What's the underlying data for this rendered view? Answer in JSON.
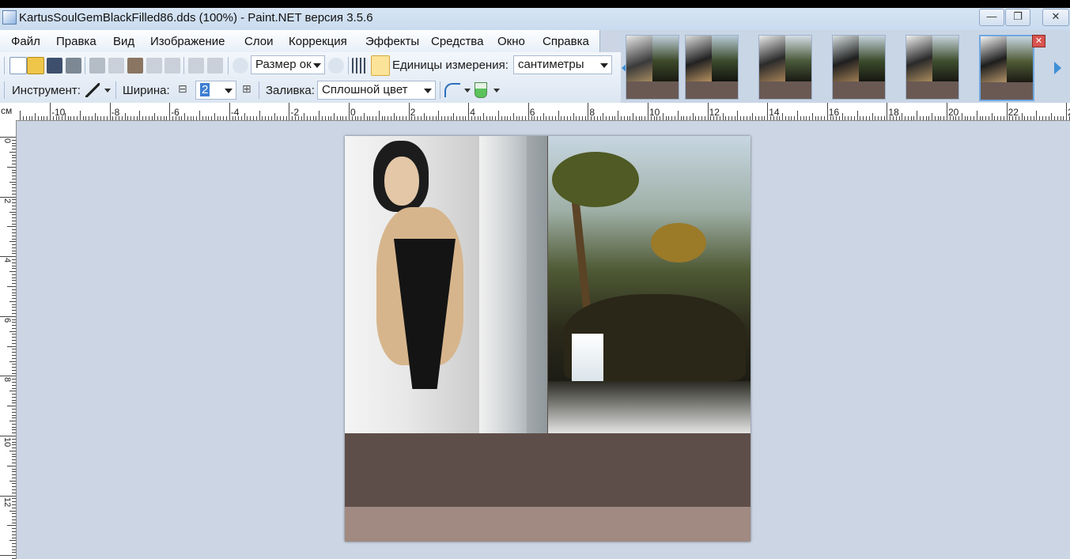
{
  "window": {
    "title": "KartusSoulGemBlackFilled86.dds (100%) - Paint.NET версия 3.5.6",
    "minimize_icon": "minimize-icon",
    "maximize_icon": "maximize-icon",
    "close_icon": "close-icon",
    "minimize_glyph": "—",
    "maximize_glyph": "❐",
    "close_glyph": "✕"
  },
  "menu": {
    "items": [
      "Файл",
      "Правка",
      "Вид",
      "Изображение",
      "Слои",
      "Коррекция",
      "Эффекты",
      "Средства",
      "Окно",
      "Справка"
    ]
  },
  "toolbar": {
    "zoom_value": "Размер ок",
    "units_label": "Единицы измерения:",
    "units_value": "сантиметры",
    "tool_label": "Инструмент:",
    "width_label": "Ширина:",
    "width_value": "2",
    "fill_label": "Заливка:",
    "fill_value": "Сплошной цвет",
    "minus_glyph": "⊟",
    "plus_glyph": "⊞"
  },
  "ruler": {
    "unit": "см",
    "h_labels": [
      "-10",
      "-8",
      "-6",
      "-4",
      "-2",
      "0",
      "2",
      "4",
      "6",
      "8",
      "10",
      "12",
      "14",
      "16",
      "18",
      "20",
      "22",
      "2"
    ],
    "v_labels": [
      "0",
      "2",
      "4",
      "6",
      "8",
      "10",
      "12"
    ]
  },
  "thumbnails": {
    "count": 6,
    "active_index": 5,
    "close_glyph": "✕"
  },
  "colors": {
    "canvas_bg": "#cbd5e3",
    "doc_band_dark": "#5e4e49",
    "doc_band_light": "#a08a82",
    "accent": "#3e7fd1"
  }
}
